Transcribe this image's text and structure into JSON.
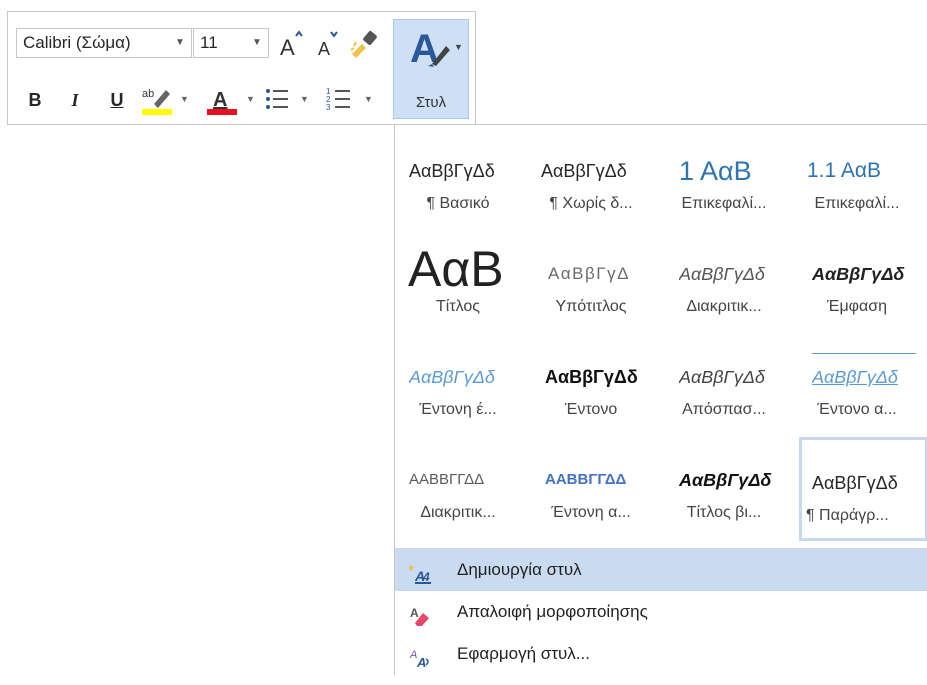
{
  "toolbar": {
    "font_name": "Calibri (Σώμα)",
    "font_size": "11",
    "bold": "B",
    "italic": "I",
    "underline": "U",
    "styles_label": "Στυλ",
    "highlight_color": "#ffff00",
    "font_color": "#e81123",
    "brand_blue": "#2b579a",
    "icons": [
      "grow-font-icon",
      "shrink-font-icon",
      "format-painter-icon",
      "highlight-icon",
      "font-color-icon",
      "bullets-icon",
      "numbering-icon",
      "styles-icon"
    ]
  },
  "gallery": {
    "cells": [
      {
        "sample": "ΑαΒβΓγΔδ",
        "name": "¶ Βασικό"
      },
      {
        "sample": "ΑαΒβΓγΔδ",
        "name": "¶ Χωρίς δ..."
      },
      {
        "sample": "1 ΑαΒ",
        "name": "Επικεφαλί..."
      },
      {
        "sample": "1.1 ΑαΒ",
        "name": "Επικεφαλί..."
      },
      {
        "sample": "ΑαΒ",
        "name": "Τίτλος"
      },
      {
        "sample": "ΑαΒβΓγΔ",
        "name": "Υπότιτλος"
      },
      {
        "sample": "ΑαΒβΓγΔδ",
        "name": "Διακριτικ..."
      },
      {
        "sample": "ΑαΒβΓγΔδ",
        "name": "Έμφαση"
      },
      {
        "sample": "ΑαΒβΓγΔδ",
        "name": "Έντονη έ..."
      },
      {
        "sample": "ΑαΒβΓγΔδ",
        "name": "Έντονο"
      },
      {
        "sample": "ΑαΒβΓγΔδ",
        "name": "Απόσπασ..."
      },
      {
        "sample": "ΑαΒβΓγΔδ",
        "name": "Έντονο α..."
      },
      {
        "sample": "ΑΑΒΒΓΓΔΔ",
        "name": "Διακριτικ..."
      },
      {
        "sample": "ΑΑΒΒΓΓΔΔ",
        "name": "Έντονη α..."
      },
      {
        "sample": "ΑαΒβΓγΔδ",
        "name": "Τίτλος βι..."
      },
      {
        "sample": "ΑαΒβΓγΔδ",
        "name": "¶ Παράγρ..."
      }
    ],
    "selected_index": 15
  },
  "menu": {
    "create_style": "Δημιουργία στυλ",
    "clear_formatting": "Απαλοιφή μορφοποίησης",
    "apply_styles": "Εφαρμογή στυλ..."
  }
}
